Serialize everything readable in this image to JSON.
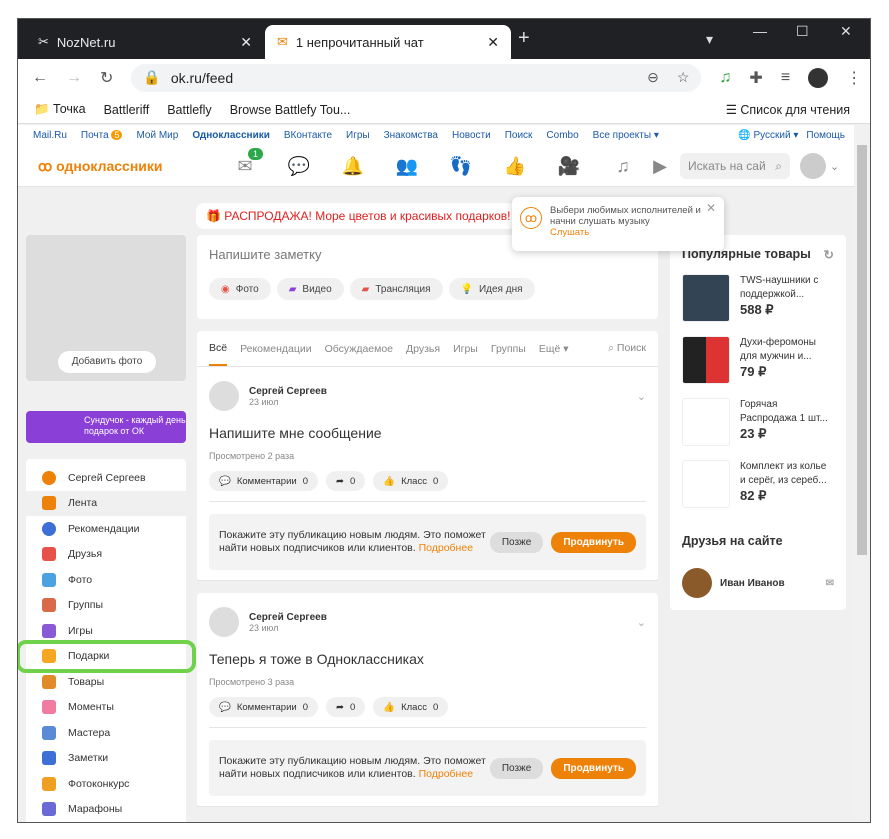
{
  "browser": {
    "tabs": [
      {
        "title": "NozNet.ru"
      },
      {
        "title": "1 непрочитанный чат",
        "active": true
      }
    ],
    "url": "ok.ru/feed",
    "bookmarks": [
      "Точка",
      "Battleriff",
      "Battlefly",
      "Browse Battlefy Tou..."
    ],
    "reading_list": "Список для чтения"
  },
  "topnav": {
    "links": [
      "Mail.Ru",
      "Почта",
      "Мой Мир",
      "Одноклассники",
      "ВКонтакте",
      "Игры",
      "Знакомства",
      "Новости",
      "Поиск",
      "Combo",
      "Все проекты ▾"
    ],
    "mail_badge": "5",
    "language": "Русский ▾",
    "help": "Помощь",
    "logo": "одноклассники",
    "messages_badge": "1",
    "search_placeholder": "Искать на сай"
  },
  "banner": "🎁 РАСПРОДАЖА! Море цветов и красивых подарков! От",
  "popup": {
    "text": "Выбери любимых исполнителей и начни слушать музыку",
    "link": "Слушать"
  },
  "left": {
    "add_photo": "Добавить фото",
    "promo": "Сундучок - каждый день подарок от ОК",
    "menu": [
      "Сергей Сергеев",
      "Лента",
      "Рекомендации",
      "Друзья",
      "Фото",
      "Группы",
      "Игры",
      "Подарки",
      "Товары",
      "Моменты",
      "Мастера",
      "Заметки",
      "Фотоконкурс",
      "Марафоны"
    ]
  },
  "composer": {
    "placeholder": "Напишите заметку",
    "buttons": [
      "Фото",
      "Видео",
      "Трансляция",
      "Идея дня"
    ]
  },
  "feed_tabs": [
    "Всё",
    "Рекомендации",
    "Обсуждаемое",
    "Друзья",
    "Игры",
    "Группы",
    "Ещё ▾"
  ],
  "feed_search": "Поиск",
  "posts": [
    {
      "author": "Сергей Сергеев",
      "date": "23 июл",
      "text": "Напишите мне сообщение",
      "views": "Просмотрено 2 раза",
      "comments": "Комментарии",
      "comments_count": "0",
      "shares": "0",
      "likes": "Класс",
      "likes_count": "0"
    },
    {
      "author": "Сергей Сергеев",
      "date": "23 июл",
      "text": "Теперь я тоже в Одноклассниках",
      "views": "Просмотрено 3 раза",
      "comments": "Комментарии",
      "comments_count": "0",
      "shares": "0",
      "likes": "Класс",
      "likes_count": "0"
    }
  ],
  "promote": {
    "text": "Покажите эту публикацию новым людям. Это поможет найти новых подписчиков или клиентов.",
    "more": "Подробнее",
    "later": "Позже",
    "boost": "Продвинуть"
  },
  "products": {
    "title": "Популярные товары",
    "items": [
      {
        "name": "TWS-наушники с поддержкой...",
        "price": "588 ₽"
      },
      {
        "name": "Духи-феромоны для мужчин и...",
        "price": "79 ₽"
      },
      {
        "name": "Горячая Распродажа 1 шт...",
        "price": "23 ₽"
      },
      {
        "name": "Комплект из колье и серёг, из сереб...",
        "price": "82 ₽"
      }
    ]
  },
  "friends": {
    "title": "Друзья на сайте",
    "items": [
      {
        "name": "Иван Иванов"
      }
    ]
  }
}
